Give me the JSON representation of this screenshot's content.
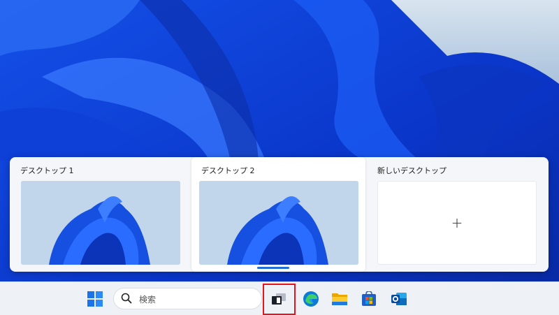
{
  "taskview": {
    "desktops": [
      {
        "title": "デスクトップ 1"
      },
      {
        "title": "デスクトップ 2"
      }
    ],
    "new_desktop": {
      "title": "新しいデスクトップ",
      "icon": "plus-icon"
    }
  },
  "taskbar": {
    "search": {
      "placeholder": "検索"
    },
    "icons": [
      "windows-start-icon",
      "search-icon",
      "task-view-icon",
      "edge-icon",
      "file-explorer-icon",
      "store-icon",
      "outlook-icon"
    ],
    "highlight_color": "#e8141a"
  },
  "colors": {
    "accent": "#1f6fd6",
    "wallpaper": "#0a3bd8"
  }
}
